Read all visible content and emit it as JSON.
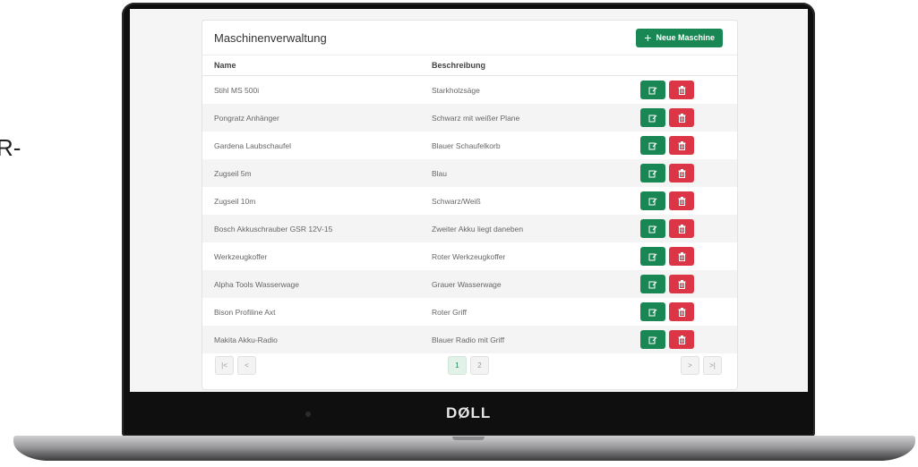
{
  "side_text": "R-",
  "brand": "DØLL",
  "app": {
    "title": "Maschinenverwaltung",
    "new_button_label": "Neue Maschine",
    "columns": {
      "name": "Name",
      "description": "Beschreibung"
    },
    "rows": [
      {
        "name": "Stihl MS 500i",
        "description": "Starkholzsäge"
      },
      {
        "name": "Pongratz Anhänger",
        "description": "Schwarz mit weißer Plane"
      },
      {
        "name": "Gardena Laubschaufel",
        "description": "Blauer Schaufelkorb"
      },
      {
        "name": "Zugseil 5m",
        "description": "Blau"
      },
      {
        "name": "Zugseil 10m",
        "description": "Schwarz/Weiß"
      },
      {
        "name": "Bosch Akkuschrauber GSR 12V-15",
        "description": "Zweiter Akku liegt daneben"
      },
      {
        "name": "Werkzeugkoffer",
        "description": "Roter Werkzeugkoffer"
      },
      {
        "name": "Alpha Tools Wasserwage",
        "description": "Grauer Wasserwage"
      },
      {
        "name": "Bison Profiline Axt",
        "description": "Roter Griff"
      },
      {
        "name": "Makita Akku-Radio",
        "description": "Blauer Radio mit Griff"
      }
    ],
    "pagination": {
      "first": "|<",
      "prev": "<",
      "pages": [
        "1",
        "2"
      ],
      "active_page": "1",
      "next": ">",
      "last": ">|"
    },
    "icons": {
      "edit": "edit-icon",
      "delete": "trash-icon",
      "add": "plus-icon"
    },
    "colors": {
      "success": "#198754",
      "danger": "#dc3545"
    }
  }
}
